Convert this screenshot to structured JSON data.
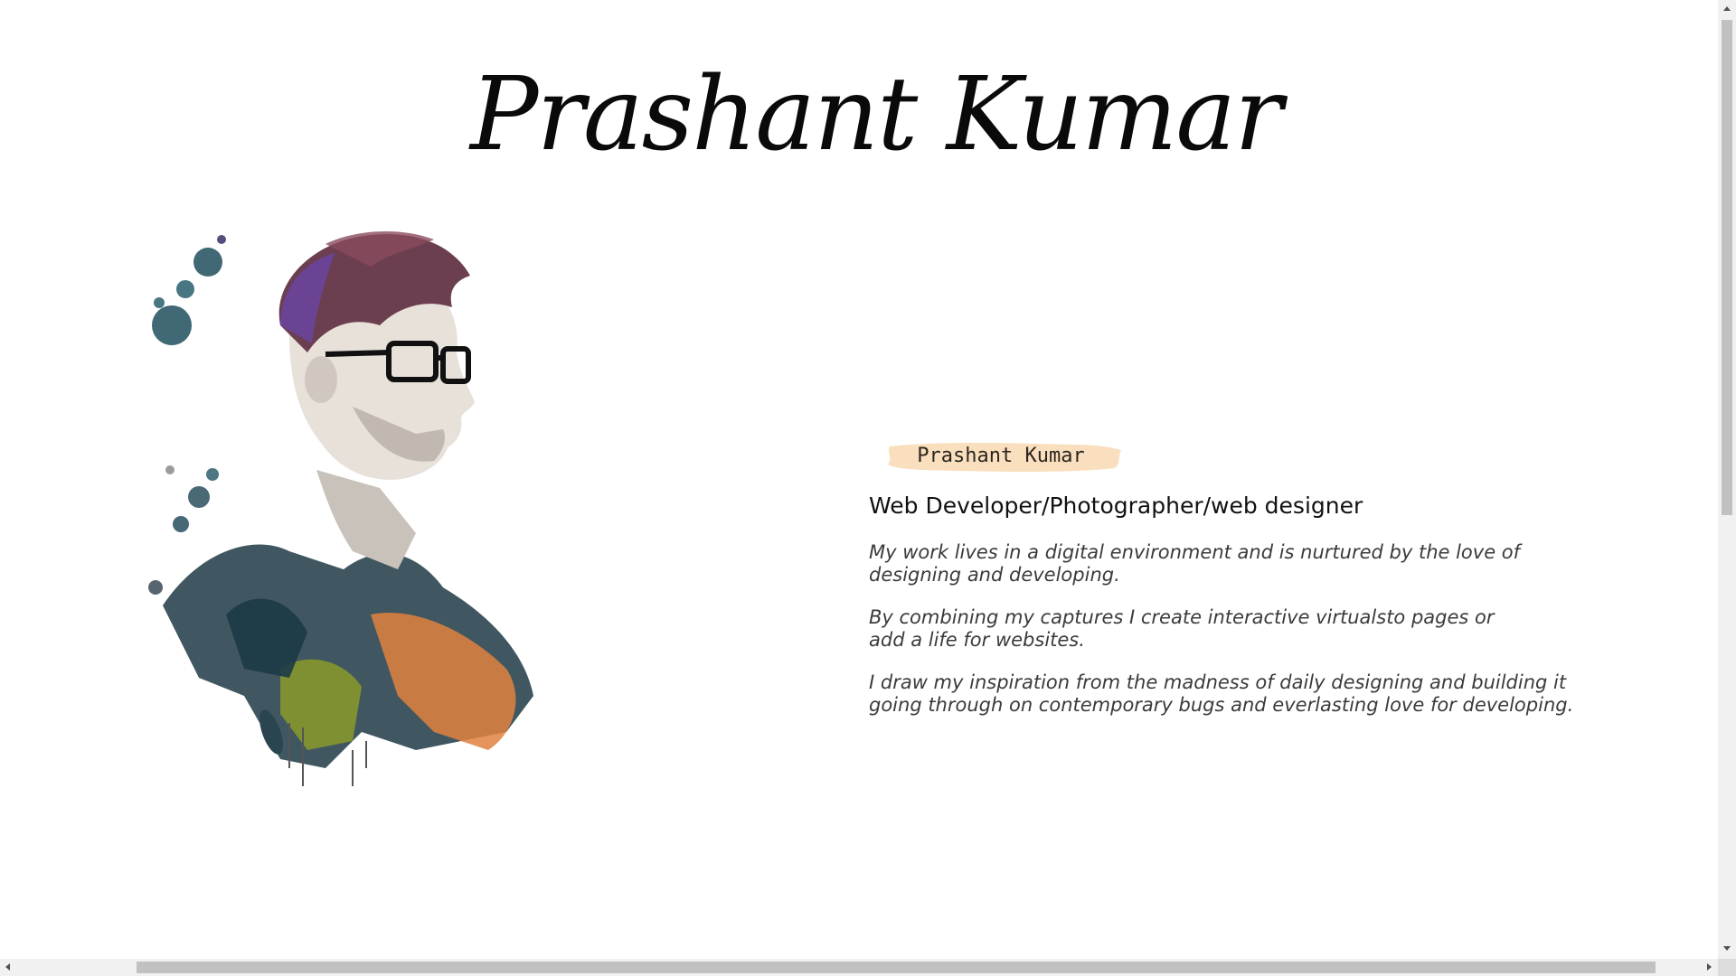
{
  "header": {
    "title": "Prashant Kumar"
  },
  "portrait": {
    "icon": "watercolor-portrait-illustration",
    "palette": [
      "#5b3a8c",
      "#1f5a6b",
      "#2d6e7a",
      "#e0833e",
      "#8a9a2a",
      "#3c4a55"
    ]
  },
  "profile": {
    "name_tag": "Prashant Kumar",
    "name_tag_color": "#f9dfbd",
    "role": "Web Developer/Photographer/web designer",
    "paragraphs": [
      {
        "line1": "My work lives in a digital environment and is nurtured by the love of",
        "line2": "designing and developing."
      },
      {
        "line1": "By combining my captures I create interactive virtualsto pages or",
        "line2": "add a life for websites."
      },
      {
        "line1": "I draw my inspiration from the madness of daily designing and building it",
        "line2": "going through on contemporary bugs and everlasting love for developing."
      }
    ]
  },
  "scrollbars": {
    "vertical_icon_up": "arrow-up-icon",
    "vertical_icon_down": "arrow-down-icon",
    "horizontal_icon_left": "arrow-left-icon",
    "horizontal_icon_right": "arrow-right-icon"
  }
}
